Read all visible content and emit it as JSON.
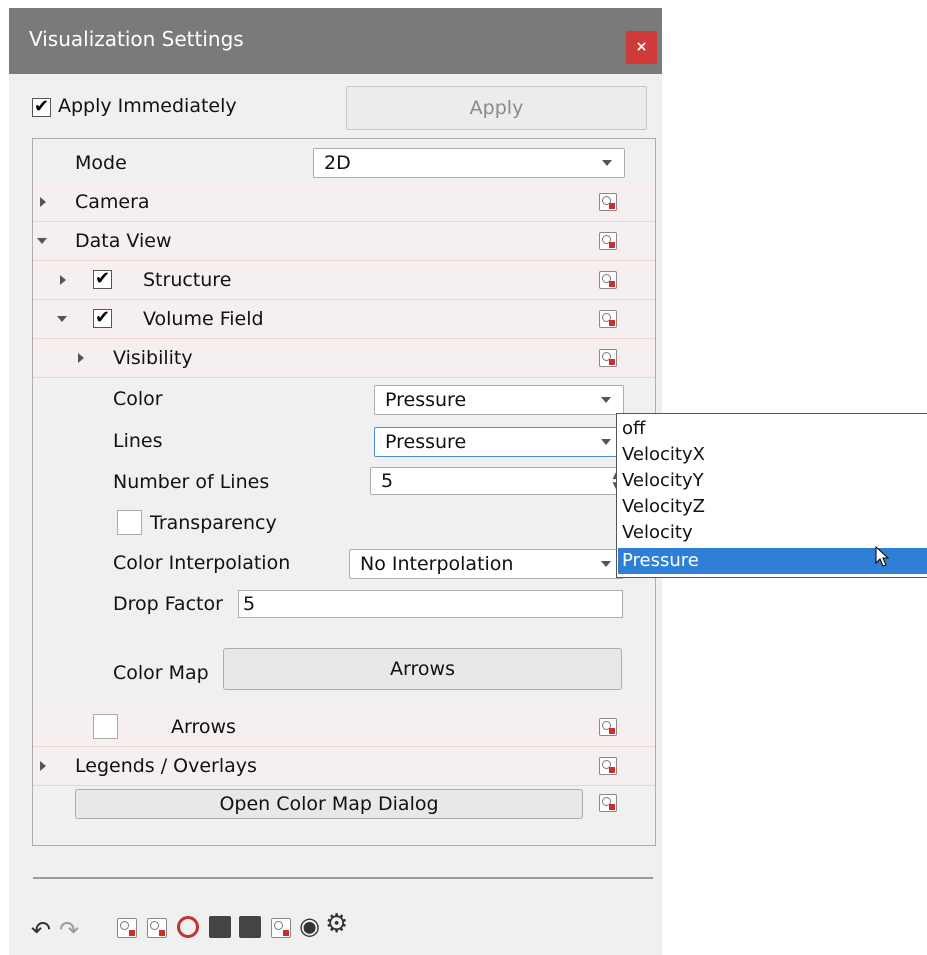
{
  "window": {
    "title": "Visualization Settings",
    "close_label": "×",
    "apply_immediately": {
      "label": "Apply Immediately",
      "checked": true,
      "check_glyph": "✔"
    },
    "apply_label": "Apply"
  },
  "tree": {
    "mode": {
      "label": "Mode",
      "value": "2D"
    },
    "camera": {
      "label": "Camera"
    },
    "data_view": {
      "label": "Data View"
    },
    "structure": {
      "label": "Structure",
      "checked": true,
      "check_glyph": "✔"
    },
    "volume_field": {
      "label": "Volume Field",
      "checked": true,
      "check_glyph": "✔"
    },
    "visibility": {
      "label": "Visibility"
    },
    "color": {
      "label": "Color",
      "value": "Pressure"
    },
    "lines": {
      "label": "Lines",
      "value": "Pressure"
    },
    "number_of_lines": {
      "label": "Number of Lines",
      "value": "5"
    },
    "transparency": {
      "label": "Transparency",
      "checked": false
    },
    "color_interpolation": {
      "label": "Color Interpolation",
      "value": "No Interpolation"
    },
    "drop_factor": {
      "label": "Drop Factor",
      "value": "5"
    },
    "color_map": {
      "label": "Color Map",
      "value": "Arrows"
    },
    "arrows": {
      "label": "Arrows",
      "checked": false
    },
    "legends": {
      "label": "Legends / Overlays"
    },
    "open_color_map_dialog": {
      "label": "Open Color Map Dialog"
    }
  },
  "dropdown": {
    "options": [
      "off",
      "VelocityX",
      "VelocityY",
      "VelocityZ",
      "Velocity",
      "Pressure"
    ],
    "selected": "Pressure"
  },
  "toolbar": {
    "undo_icon": "↶",
    "redo_icon": "↷",
    "eye_icon": "◉",
    "gear_icon": "⚙"
  },
  "colors": {
    "accent": "#2f7fd6",
    "titlebar": "#7a7a7a",
    "close": "#cf3b3b",
    "row_header": "#f6efef"
  }
}
